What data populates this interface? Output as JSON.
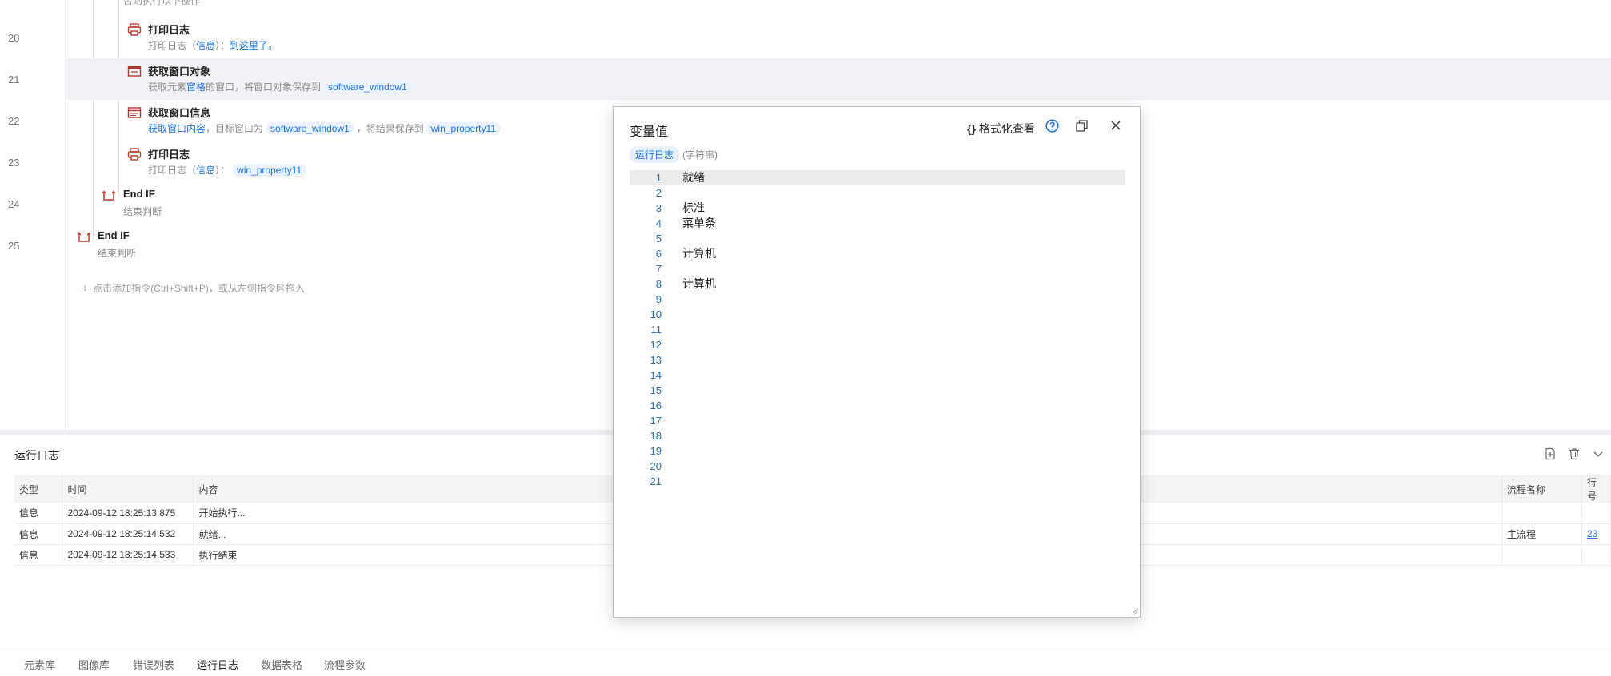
{
  "editor": {
    "cut_text": "否则执行以下操作",
    "line_numbers": [
      "20",
      "21",
      "22",
      "23",
      "24",
      "25"
    ],
    "steps": [
      {
        "title": "打印日志",
        "desc_parts": [
          {
            "t": "打印日志（"
          },
          {
            "t": "信息",
            "link": true
          },
          {
            "t": "）："
          },
          {
            "t": "到这里了。",
            "link": true
          }
        ]
      },
      {
        "title": "获取窗口对象",
        "desc_parts": [
          {
            "t": "获取元素"
          },
          {
            "t": "窗格",
            "link": true
          },
          {
            "t": "的窗口，将窗口对象保存到"
          },
          {
            "t": "software_window1",
            "tag": true
          }
        ]
      },
      {
        "title": "获取窗口信息",
        "desc_parts": [
          {
            "t": "获取窗口内容",
            "link": true
          },
          {
            "t": "，目标窗口为"
          },
          {
            "t": "software_window1",
            "tag": true
          },
          {
            "t": "，将结果保存到"
          },
          {
            "t": "win_property11",
            "tag": true
          }
        ]
      },
      {
        "title": "打印日志",
        "desc_parts": [
          {
            "t": "打印日志（"
          },
          {
            "t": "信息",
            "link": true
          },
          {
            "t": "）："
          },
          {
            "t": "win_property11",
            "tag": true
          }
        ]
      },
      {
        "title": "End IF",
        "desc_parts": [
          {
            "t": "结束判断"
          }
        ]
      },
      {
        "title": "End IF",
        "desc_parts": [
          {
            "t": "结束判断"
          }
        ]
      }
    ],
    "add_command": "点击添加指令(Ctrl+Shift+P)，或从左侧指令区拖入"
  },
  "runlog": {
    "title": "运行日志",
    "columns": [
      "类型",
      "时间",
      "内容",
      "流程名称",
      "行号"
    ],
    "rows": [
      [
        "信息",
        "2024-09-12 18:25:13.875",
        "开始执行...",
        "",
        ""
      ],
      [
        "信息",
        "2024-09-12 18:25:14.532",
        "就绪...",
        "主流程",
        "23"
      ],
      [
        "信息",
        "2024-09-12 18:25:14.533",
        "执行结束",
        "",
        ""
      ]
    ]
  },
  "tabs": [
    "元素库",
    "图像库",
    "错误列表",
    "运行日志",
    "数据表格",
    "流程参数"
  ],
  "active_tab": "运行日志",
  "popup": {
    "title": "变量值",
    "format_label": "格式化查看",
    "format_icon": "{}",
    "var_name": "运行日志",
    "var_type": "(字符串)",
    "lines": [
      "就绪",
      "",
      "标准",
      "菜单条",
      "",
      "计算机",
      "",
      "计算机",
      "",
      "",
      "",
      "",
      "",
      "",
      "",
      "",
      "",
      "",
      "",
      "",
      ""
    ],
    "line_numbers": [
      "1",
      "2",
      "3",
      "4",
      "5",
      "6",
      "7",
      "8",
      "9",
      "10",
      "11",
      "12",
      "13",
      "14",
      "15",
      "16",
      "17",
      "18",
      "19",
      "20",
      "21"
    ]
  },
  "colors": {
    "accent": "#1a73e8",
    "highlight_row": "#f1f2f5"
  }
}
